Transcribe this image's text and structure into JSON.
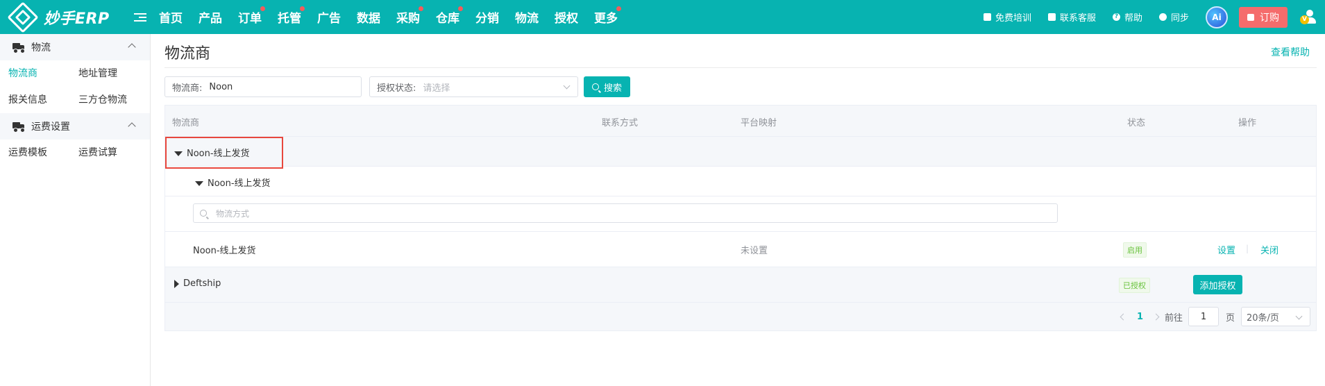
{
  "app": {
    "logo_text": "妙手ERP"
  },
  "nav": {
    "items": [
      {
        "label": "首页",
        "dot": false
      },
      {
        "label": "产品",
        "dot": false
      },
      {
        "label": "订单",
        "dot": true
      },
      {
        "label": "托管",
        "dot": true
      },
      {
        "label": "广告",
        "dot": false
      },
      {
        "label": "数据",
        "dot": false
      },
      {
        "label": "采购",
        "dot": true
      },
      {
        "label": "仓库",
        "dot": true
      },
      {
        "label": "分销",
        "dot": false
      },
      {
        "label": "物流",
        "dot": false
      },
      {
        "label": "授权",
        "dot": false
      },
      {
        "label": "更多",
        "dot": true
      }
    ]
  },
  "topright": {
    "training": "免费培训",
    "service": "联系客服",
    "help": "帮助",
    "sync": "同步",
    "ai": "Ai",
    "order": "订购",
    "vip": "V"
  },
  "sidebar": {
    "group1": {
      "label": "物流",
      "links": [
        "物流商",
        "地址管理",
        "报关信息",
        "三方仓物流"
      ],
      "active": "物流商"
    },
    "group2": {
      "label": "运费设置",
      "links": [
        "运费模板",
        "运费试算"
      ]
    }
  },
  "page": {
    "title": "物流商",
    "help": "查看帮助"
  },
  "filters": {
    "provider_label": "物流商:",
    "provider_value": "Noon",
    "auth_label": "授权状态:",
    "auth_placeholder": "请选择",
    "search_label": "搜索"
  },
  "table": {
    "headers": {
      "provider": "物流商",
      "contact": "联系方式",
      "mapping": "平台映射",
      "status": "状态",
      "action": "操作"
    },
    "group_row": {
      "label": "Noon-线上发货"
    },
    "sub_group_row": {
      "label": "Noon-线上发货"
    },
    "method_search_placeholder": "物流方式",
    "method_row": {
      "name": "Noon-线上发货",
      "mapping": "未设置",
      "status": "启用",
      "action_set": "设置",
      "action_close": "关闭",
      "separator": "|"
    },
    "deftship_row": {
      "label": "Deftship",
      "status": "已授权",
      "action": "添加授权"
    }
  },
  "pagination": {
    "current": "1",
    "goto_label": "前往",
    "goto_value": "1",
    "page_suffix": "页",
    "page_size": "20条/页"
  },
  "colors": {
    "brand": "#07b3b1",
    "highlight": "#e8473d",
    "order_btn": "#f56c6c"
  }
}
